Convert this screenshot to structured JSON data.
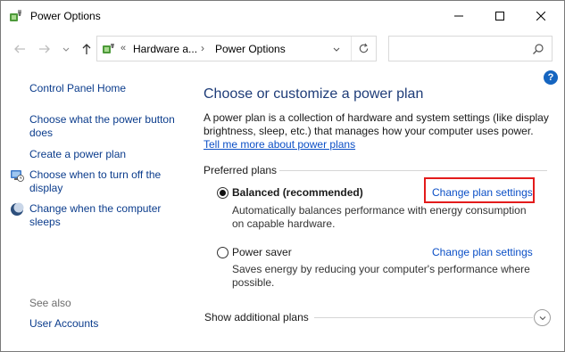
{
  "window": {
    "title": "Power Options"
  },
  "address": {
    "segment1": "Hardware a...",
    "segment2": "Power Options",
    "chevron": "«",
    "separator": "›"
  },
  "search": {
    "placeholder": ""
  },
  "help": {
    "label": "?"
  },
  "left_pane": {
    "home": "Control Panel Home",
    "items": [
      {
        "label": "Choose what the power button does",
        "icon": null
      },
      {
        "label": "Create a power plan",
        "icon": null
      },
      {
        "label": "Choose when to turn off the display",
        "icon": "display-clock-icon"
      },
      {
        "label": "Change when the computer sleeps",
        "icon": "moon-sleep-icon"
      }
    ],
    "see_also": "See also",
    "see_also_items": [
      "User Accounts"
    ]
  },
  "main": {
    "title": "Choose or customize a power plan",
    "description": "A power plan is a collection of hardware and system settings (like display brightness, sleep, etc.) that manages how your computer uses power. ",
    "description_link": "Tell me more about power plans",
    "group_label": "Preferred plans",
    "plans": [
      {
        "name": "Balanced (recommended)",
        "selected": true,
        "description": "Automatically balances performance with energy consumption on capable hardware.",
        "link": "Change plan settings"
      },
      {
        "name": "Power saver",
        "selected": false,
        "description": "Saves energy by reducing your computer's performance where possible.",
        "link": "Change plan settings"
      }
    ],
    "show_additional": "Show additional plans"
  },
  "colors": {
    "link": "#0b4fc6",
    "title": "#1e3c78",
    "highlight": "#e31b1b"
  }
}
